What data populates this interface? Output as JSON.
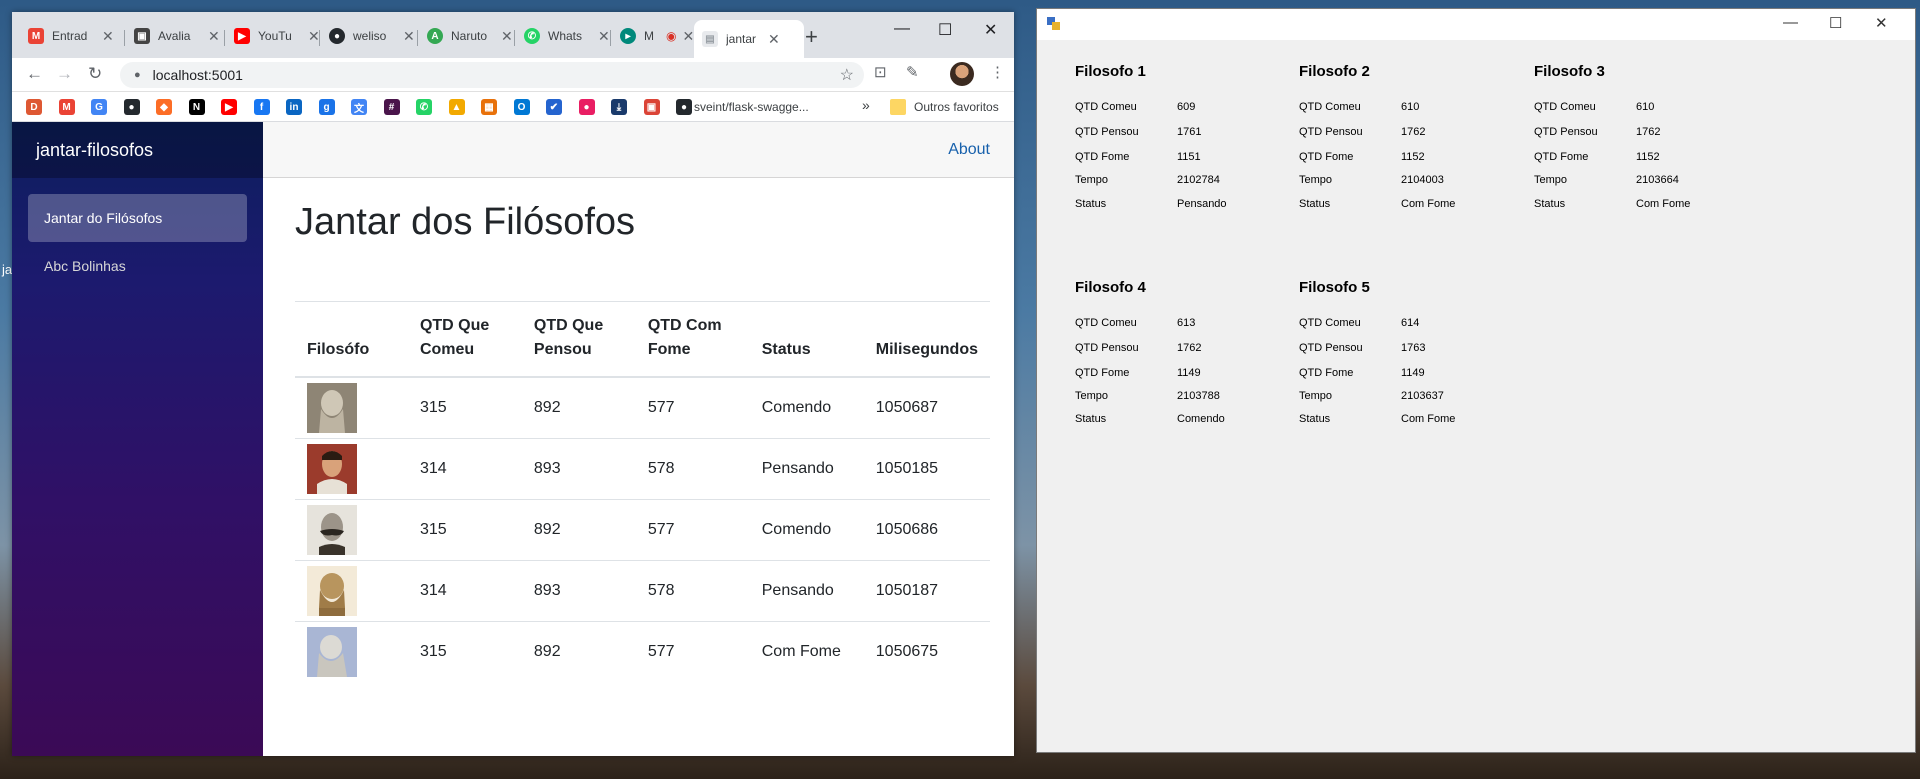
{
  "desktop": {
    "left_text": "ja"
  },
  "browser": {
    "tabs": [
      {
        "label": "Entrad",
        "icon": "gmail-icon",
        "color": "#ea4335"
      },
      {
        "label": "Avalia",
        "icon": "classroom-icon",
        "color": "#444444"
      },
      {
        "label": "YouTu",
        "icon": "youtube-icon",
        "color": "#ff0000"
      },
      {
        "label": "weliso",
        "icon": "github-icon",
        "color": "#24292e"
      },
      {
        "label": "Naruto",
        "icon": "android-icon",
        "color": "#34a853"
      },
      {
        "label": "Whats",
        "icon": "whatsapp-icon",
        "color": "#25d366"
      },
      {
        "label": "M",
        "icon": "meet-icon",
        "color": "#00897b"
      },
      {
        "label": "jantar",
        "icon": "page-icon",
        "color": "#9aa0a6"
      }
    ],
    "url": "localhost:5001",
    "bookmarks": {
      "icons": [
        {
          "icon": "duckduckgo-icon",
          "color": "#de5833",
          "glyph": "D"
        },
        {
          "icon": "gmail-icon",
          "color": "#ea4335",
          "glyph": "M"
        },
        {
          "icon": "google-icon",
          "color": "#4285f4",
          "glyph": "G"
        },
        {
          "icon": "github-icon",
          "color": "#24292e",
          "glyph": "●"
        },
        {
          "icon": "gitlab-icon",
          "color": "#fc6d26",
          "glyph": "◆"
        },
        {
          "icon": "notion-icon",
          "color": "#000000",
          "glyph": "N"
        },
        {
          "icon": "youtube-icon",
          "color": "#ff0000",
          "glyph": "▶"
        },
        {
          "icon": "facebook-icon",
          "color": "#1877f2",
          "glyph": "f"
        },
        {
          "icon": "linkedin-icon",
          "color": "#0a66c2",
          "glyph": "in"
        },
        {
          "icon": "g-icon",
          "color": "#1a73e8",
          "glyph": "g"
        },
        {
          "icon": "translate-icon",
          "color": "#4285f4",
          "glyph": "文"
        },
        {
          "icon": "slack-icon",
          "color": "#4a154b",
          "glyph": "#"
        },
        {
          "icon": "whatsapp-icon",
          "color": "#25d366",
          "glyph": "✆"
        },
        {
          "icon": "unesp-icon",
          "color": "#f2a900",
          "glyph": "▲"
        },
        {
          "icon": "calendar-icon",
          "color": "#e8710a",
          "glyph": "▦"
        },
        {
          "icon": "outlook-icon",
          "color": "#0078d4",
          "glyph": "O"
        },
        {
          "icon": "todo-icon",
          "color": "#2564cf",
          "glyph": "✔"
        },
        {
          "icon": "record-icon",
          "color": "#e91e63",
          "glyph": "●"
        },
        {
          "icon": "download-icon",
          "color": "#1a3a6b",
          "glyph": "⤓"
        },
        {
          "icon": "calendar-check-icon",
          "color": "#db4437",
          "glyph": "▣"
        },
        {
          "icon": "github-icon",
          "color": "#24292e",
          "glyph": "●"
        }
      ],
      "last_label": "sveint/flask-swagge...",
      "more": "»",
      "other_favorites": "Outros favoritos"
    }
  },
  "app": {
    "brand": "jantar-filosofos",
    "sidebar": [
      {
        "label": "Jantar do Filósofos",
        "active": true
      },
      {
        "label": "Abc Bolinhas",
        "active": false
      }
    ],
    "about": "About",
    "title": "Jantar dos Filósofos",
    "table": {
      "headers": [
        "Filosófo",
        "QTD Que Comeu",
        "QTD Que Pensou",
        "QTD Com Fome",
        "Status",
        "Milisegundos"
      ],
      "rows": [
        {
          "comeu": "315",
          "pensou": "892",
          "fome": "577",
          "status": "Comendo",
          "ms": "1050687"
        },
        {
          "comeu": "314",
          "pensou": "893",
          "fome": "578",
          "status": "Pensando",
          "ms": "1050185"
        },
        {
          "comeu": "315",
          "pensou": "892",
          "fome": "577",
          "status": "Comendo",
          "ms": "1050686"
        },
        {
          "comeu": "314",
          "pensou": "893",
          "fome": "578",
          "status": "Pensando",
          "ms": "1050187"
        },
        {
          "comeu": "315",
          "pensou": "892",
          "fome": "577",
          "status": "Com Fome",
          "ms": "1050675"
        }
      ]
    }
  },
  "winform": {
    "labels": {
      "comeu": "QTD Comeu",
      "pensou": "QTD Pensou",
      "fome": "QTD Fome",
      "tempo": "Tempo",
      "status": "Status"
    },
    "philosophers": [
      {
        "title": "Filosofo 1",
        "comeu": "609",
        "pensou": "1761",
        "fome": "1151",
        "tempo": "2102784",
        "status": "Pensando"
      },
      {
        "title": "Filosofo 2",
        "comeu": "610",
        "pensou": "1762",
        "fome": "1152",
        "tempo": "2104003",
        "status": "Com Fome"
      },
      {
        "title": "Filosofo 3",
        "comeu": "610",
        "pensou": "1762",
        "fome": "1152",
        "tempo": "2103664",
        "status": "Com Fome"
      },
      {
        "title": "Filosofo 4",
        "comeu": "613",
        "pensou": "1762",
        "fome": "1149",
        "tempo": "2103788",
        "status": "Comendo"
      },
      {
        "title": "Filosofo 5",
        "comeu": "614",
        "pensou": "1763",
        "fome": "1149",
        "tempo": "2103637",
        "status": "Com Fome"
      }
    ]
  }
}
